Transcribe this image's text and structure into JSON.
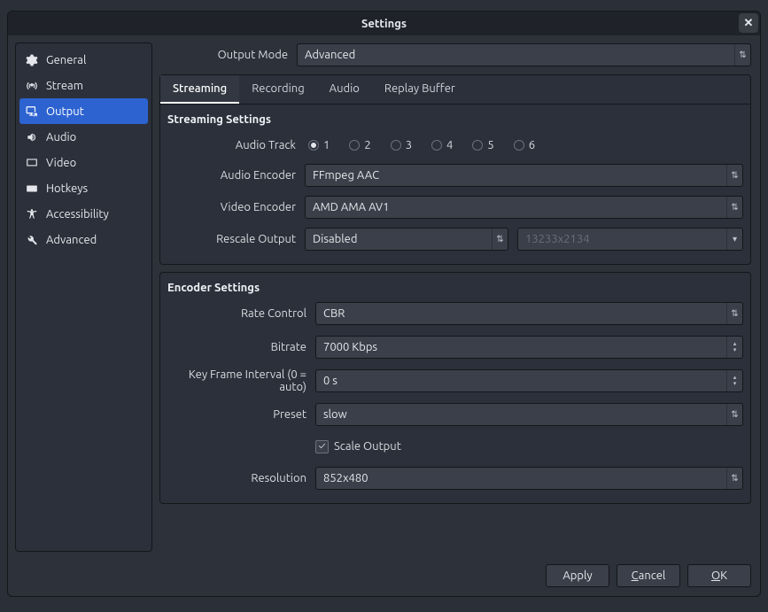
{
  "title": "Settings",
  "sidebar": {
    "items": [
      {
        "icon": "gear-icon",
        "label": "General"
      },
      {
        "icon": "antenna-icon",
        "label": "Stream"
      },
      {
        "icon": "monitor-out-icon",
        "label": "Output"
      },
      {
        "icon": "speaker-icon",
        "label": "Audio"
      },
      {
        "icon": "display-icon",
        "label": "Video"
      },
      {
        "icon": "keyboard-icon",
        "label": "Hotkeys"
      },
      {
        "icon": "accessibility-icon",
        "label": "Accessibility"
      },
      {
        "icon": "tools-icon",
        "label": "Advanced"
      }
    ],
    "active_index": 2
  },
  "output_mode": {
    "label": "Output Mode",
    "value": "Advanced"
  },
  "tabs": {
    "items": [
      "Streaming",
      "Recording",
      "Audio",
      "Replay Buffer"
    ],
    "active_index": 0
  },
  "streaming": {
    "section_title": "Streaming Settings",
    "audio_track": {
      "label": "Audio Track",
      "options": [
        "1",
        "2",
        "3",
        "4",
        "5",
        "6"
      ],
      "selected_index": 0
    },
    "audio_encoder": {
      "label": "Audio Encoder",
      "value": "FFmpeg AAC"
    },
    "video_encoder": {
      "label": "Video Encoder",
      "value": "AMD AMA AV1"
    },
    "rescale": {
      "label": "Rescale Output",
      "value": "Disabled",
      "resolution": "13233x2134"
    }
  },
  "encoder": {
    "section_title": "Encoder Settings",
    "rate_control": {
      "label": "Rate Control",
      "value": "CBR"
    },
    "bitrate": {
      "label": "Bitrate",
      "value": "7000 Kbps"
    },
    "key_interval": {
      "label": "Key Frame Interval (0 = auto)",
      "value": "0 s"
    },
    "preset": {
      "label": "Preset",
      "value": "slow"
    },
    "scale_output": {
      "label": "Scale Output",
      "checked": true
    },
    "resolution": {
      "label": "Resolution",
      "value": "852x480"
    }
  },
  "footer": {
    "apply": "Apply",
    "cancel": "Cancel",
    "ok": "OK"
  },
  "colors": {
    "accent": "#2d63d1",
    "panel": "#2b303a",
    "input": "#3a3f49",
    "border": "#14161a"
  }
}
